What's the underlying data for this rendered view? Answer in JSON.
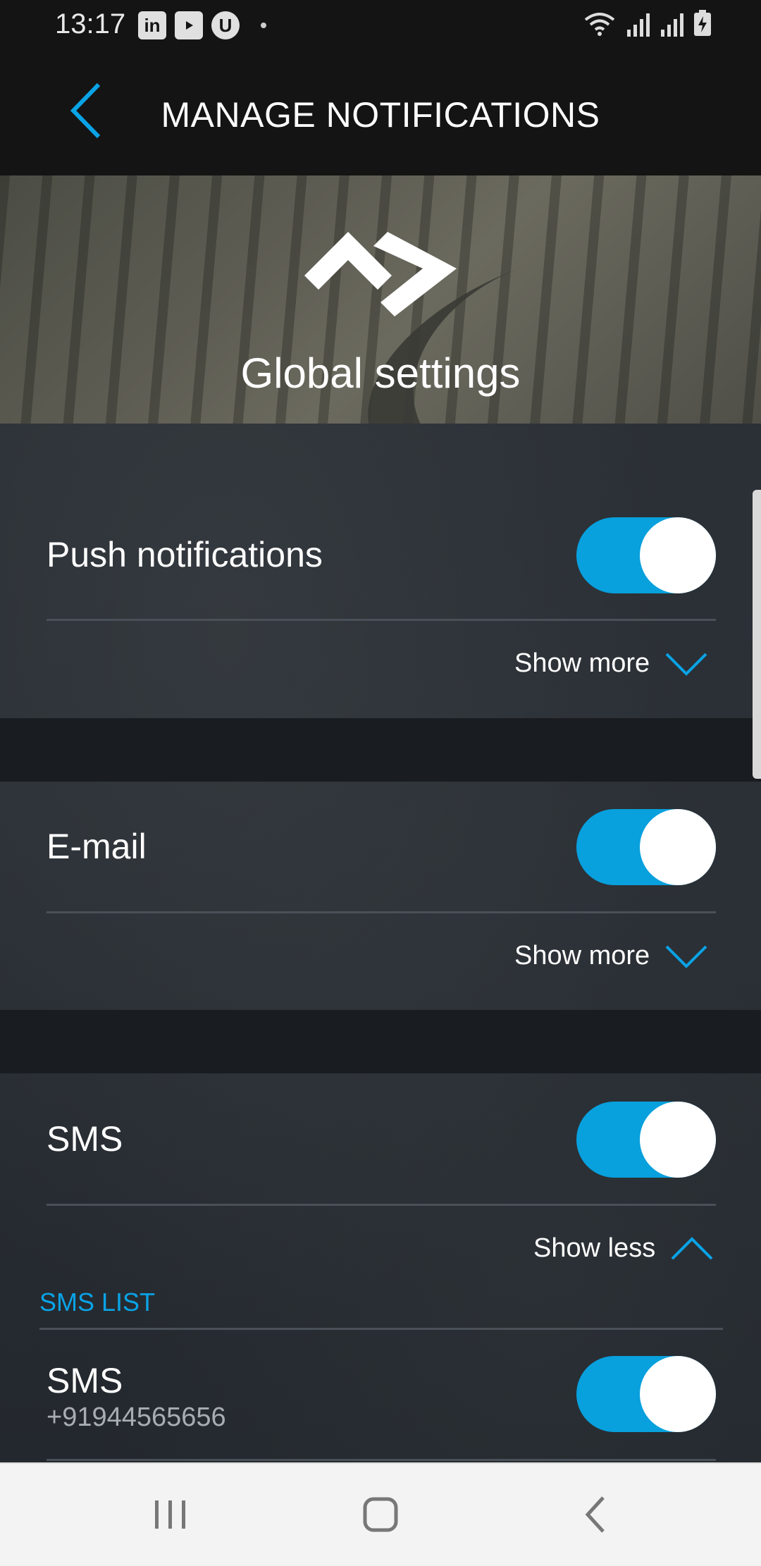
{
  "status_bar": {
    "time": "13:17",
    "left_icons": [
      "linkedin-icon",
      "youtube-icon",
      "upwork-icon",
      "dot-icon"
    ],
    "right_icons": [
      "wifi-icon",
      "signal-icon",
      "signal-icon",
      "battery-charging-icon"
    ]
  },
  "header": {
    "title": "MANAGE NOTIFICATIONS",
    "back_icon": "chevron-left-icon"
  },
  "hero": {
    "title": "Global settings",
    "logo_icon": "brand-logo-icon"
  },
  "settings": [
    {
      "label": "Push notifications",
      "enabled": true,
      "toggle_label": "Show more",
      "expanded": false
    },
    {
      "label": "E-mail",
      "enabled": true,
      "toggle_label": "Show more",
      "expanded": false
    },
    {
      "label": "SMS",
      "enabled": true,
      "toggle_label": "Show less",
      "expanded": true
    }
  ],
  "sms_list": {
    "title": "SMS LIST",
    "items": [
      {
        "label": "SMS",
        "number": "+91944565656",
        "enabled": true
      }
    ]
  },
  "colors": {
    "accent": "#08a0dd",
    "header_bg": "#141414",
    "section_title": "#0aa3e6"
  },
  "nav_bar": {
    "icons": [
      "recent-apps-icon",
      "home-icon",
      "back-icon"
    ]
  }
}
